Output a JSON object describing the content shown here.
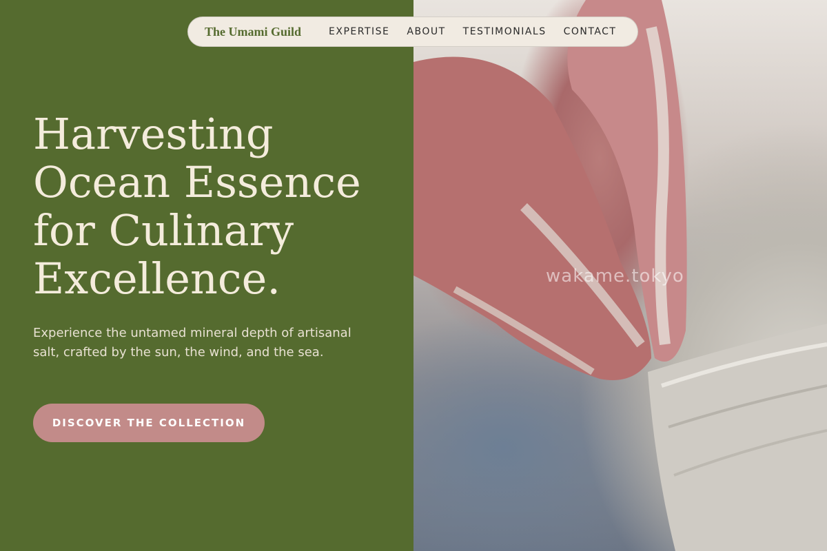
{
  "nav": {
    "brand": "The Umami Guild",
    "links": [
      {
        "label": "EXPERTISE"
      },
      {
        "label": "ABOUT"
      },
      {
        "label": "TESTIMONIALS"
      },
      {
        "label": "CONTACT"
      }
    ]
  },
  "hero": {
    "title": "Harvesting Ocean Essence for Culinary Excellence.",
    "subtitle": "Experience the untamed mineral depth of artisanal salt, crafted by the sun, the wind, and the sea.",
    "cta_label": "DISCOVER THE COLLECTION"
  },
  "image": {
    "watermark": "wakame.tokyo"
  },
  "colors": {
    "panel": "#556b2f",
    "nav_bg": "#f1ebe2",
    "title": "#f4ecdc",
    "cta": "#c28b89"
  }
}
